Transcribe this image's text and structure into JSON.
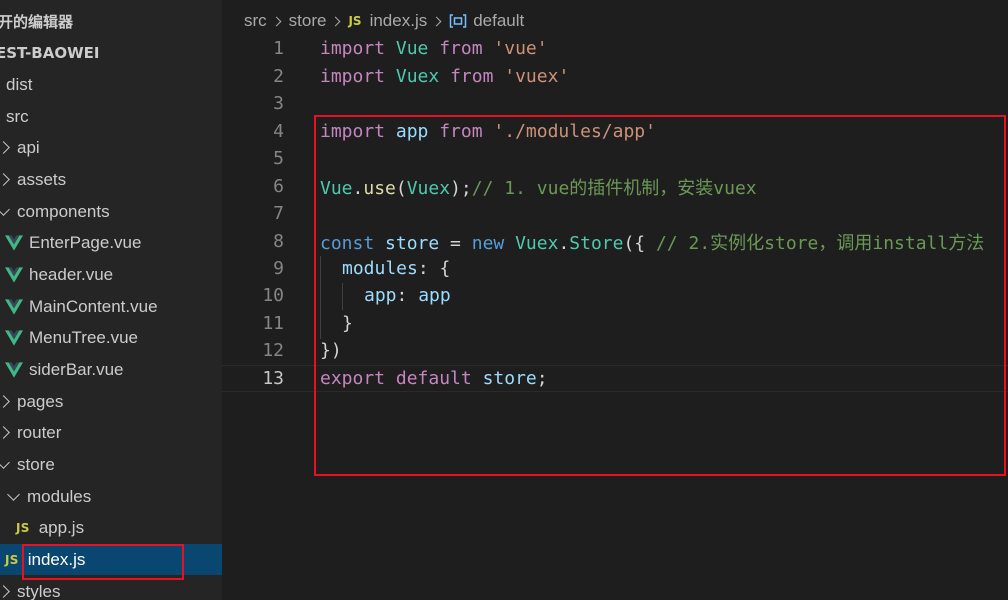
{
  "sidebar": {
    "section_title": "开的编辑器",
    "project_title": "EST-BAOWEI",
    "tree": [
      {
        "label": "dist"
      },
      {
        "label": "src"
      },
      {
        "label": "api"
      },
      {
        "label": "assets"
      },
      {
        "label": "components"
      },
      {
        "label": "EnterPage.vue"
      },
      {
        "label": "header.vue"
      },
      {
        "label": "MainContent.vue"
      },
      {
        "label": "MenuTree.vue"
      },
      {
        "label": "siderBar.vue"
      },
      {
        "label": "pages"
      },
      {
        "label": "router"
      },
      {
        "label": "store"
      },
      {
        "label": "modules"
      },
      {
        "label": "app.js"
      },
      {
        "label": "index.js"
      },
      {
        "label": "styles"
      }
    ],
    "js_badge": "JS"
  },
  "breadcrumb": {
    "items": [
      "src",
      "store",
      "index.js",
      "default"
    ],
    "js_badge": "JS"
  },
  "editor": {
    "line_numbers": [
      "1",
      "2",
      "3",
      "4",
      "5",
      "6",
      "7",
      "8",
      "9",
      "10",
      "11",
      "12",
      "13"
    ],
    "lines": {
      "l1": {
        "kw1": "import",
        "id": " Vue ",
        "kw2": "from",
        "str": " 'vue'"
      },
      "l2": {
        "kw1": "import",
        "id": " Vuex ",
        "kw2": "from",
        "str": " 'vuex'"
      },
      "l4": {
        "kw1": "import",
        "id": " app ",
        "kw2": "from",
        "str": " './modules/app'"
      },
      "l6": {
        "obj": "Vue",
        "dot": ".",
        "fn": "use",
        "open": "(",
        "arg": "Vuex",
        "close": ");",
        "comment": "// 1. vue的插件机制，安装vuex"
      },
      "l8": {
        "kw": "const",
        "var": " store ",
        "eq": "= ",
        "new": "new",
        "cls1": " Vuex",
        "dot": ".",
        "cls2": "Store",
        "open": "({ ",
        "comment": "// 2.实例化store，调用install方法"
      },
      "l9": {
        "prop": "modules",
        "rest": ": {"
      },
      "l10": {
        "prop": "app",
        "colon": ": ",
        "val": "app"
      },
      "l11": {
        "text": "}"
      },
      "l12": {
        "text": "})"
      },
      "l13": {
        "kw1": "export",
        "kw2": " default",
        "var": " store",
        "semi": ";"
      }
    }
  }
}
